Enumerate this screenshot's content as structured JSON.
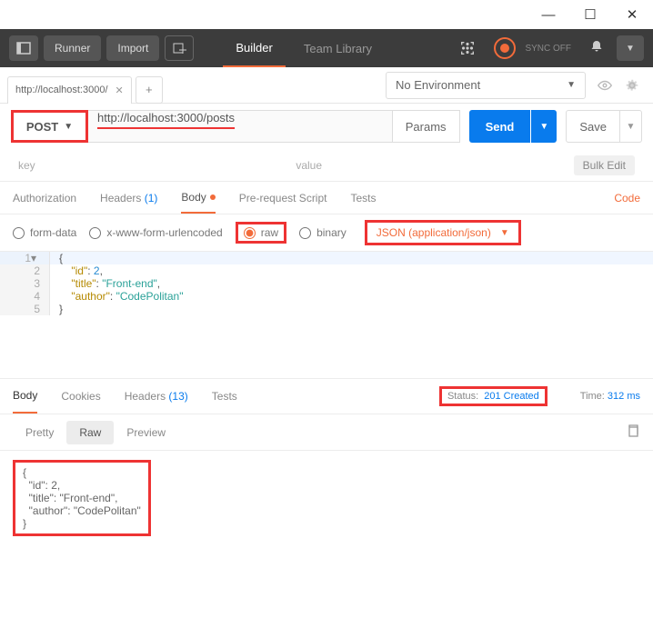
{
  "titlebar": {
    "min": "—",
    "max": "☐",
    "close": "✕"
  },
  "topbar": {
    "runner": "Runner",
    "import": "Import",
    "builder": "Builder",
    "team_library": "Team Library",
    "sync_off": "SYNC OFF"
  },
  "env": {
    "tab_label": "http://localhost:3000/",
    "dropdown": "No Environment"
  },
  "request": {
    "method": "POST",
    "url": "http://localhost:3000/posts",
    "params": "Params",
    "send": "Send",
    "save": "Save"
  },
  "kv": {
    "key": "key",
    "value": "value",
    "bulk": "Bulk Edit"
  },
  "reqtabs": {
    "auth": "Authorization",
    "headers": "Headers",
    "headers_count": "(1)",
    "body": "Body",
    "prereq": "Pre-request Script",
    "tests": "Tests",
    "code": "Code"
  },
  "bodytype": {
    "form": "form-data",
    "xwww": "x-www-form-urlencoded",
    "raw": "raw",
    "binary": "binary",
    "json": "JSON (application/json)"
  },
  "editor": {
    "l1": "{",
    "l2_k": "\"id\"",
    "l2_v": "2",
    "l3_k": "\"title\"",
    "l3_v": "\"Front-end\"",
    "l4_k": "\"author\"",
    "l4_v": "\"CodePolitan\"",
    "l5": "}"
  },
  "resptabs": {
    "body": "Body",
    "cookies": "Cookies",
    "headers": "Headers",
    "headers_count": "(13)",
    "tests": "Tests",
    "status_label": "Status:",
    "status_val": "201 Created",
    "time_label": "Time:",
    "time_val": "312 ms"
  },
  "resptoolbar": {
    "pretty": "Pretty",
    "raw": "Raw",
    "preview": "Preview"
  },
  "respbody": "{\n  \"id\": 2,\n  \"title\": \"Front-end\",\n  \"author\": \"CodePolitan\"\n}"
}
